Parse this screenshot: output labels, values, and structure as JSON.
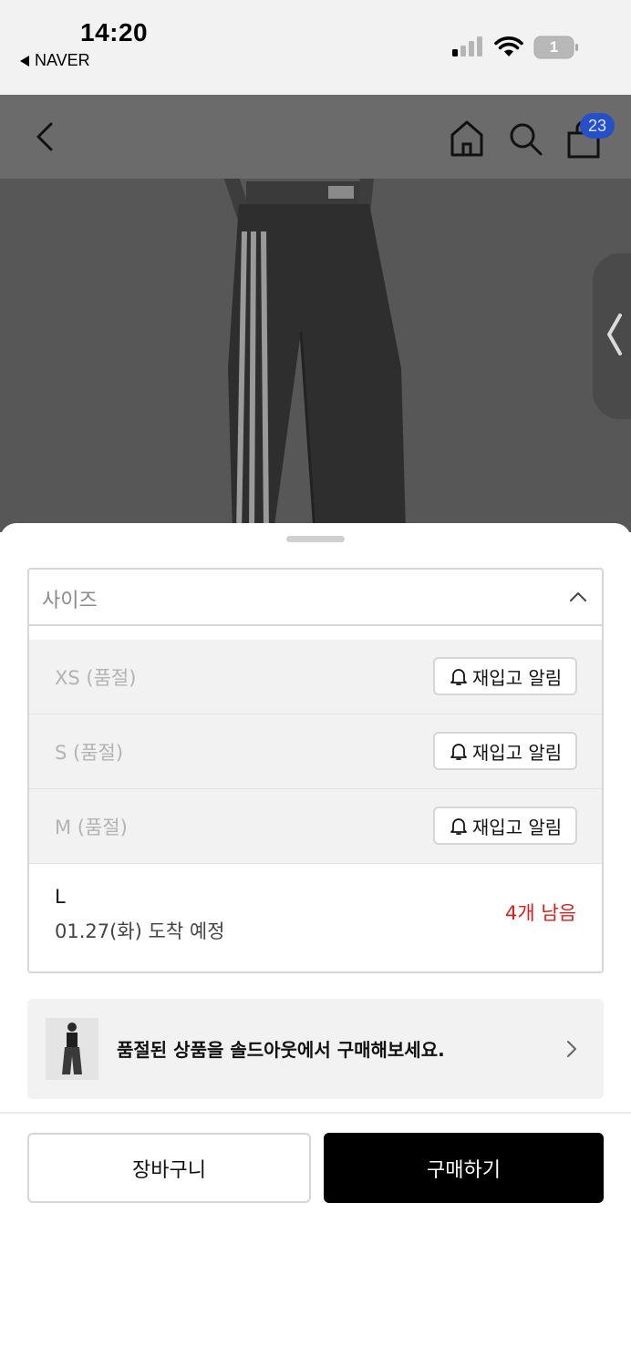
{
  "status_bar": {
    "time": "14:20",
    "back_app": "NAVER",
    "battery_level": "1"
  },
  "header": {
    "cart_count": "23"
  },
  "size_selector": {
    "label": "사이즈",
    "options": [
      {
        "label": "XS (품절)",
        "restock_label": "재입고 알림"
      },
      {
        "label": "S (품절)",
        "restock_label": "재입고 알림"
      },
      {
        "label": "M (품절)",
        "restock_label": "재입고 알림"
      }
    ],
    "available": {
      "size": "L",
      "eta": "01.27(화) 도착 예정",
      "stock": "4개 남음"
    }
  },
  "soldout_banner": {
    "text": "품절된 상품을 솔드아웃에서 구매해보세요."
  },
  "actions": {
    "cart_label": "장바구니",
    "buy_label": "구매하기"
  },
  "colors": {
    "accent_red": "#d6211e",
    "badge_blue": "#2550c8",
    "primary_button": "#000000"
  }
}
